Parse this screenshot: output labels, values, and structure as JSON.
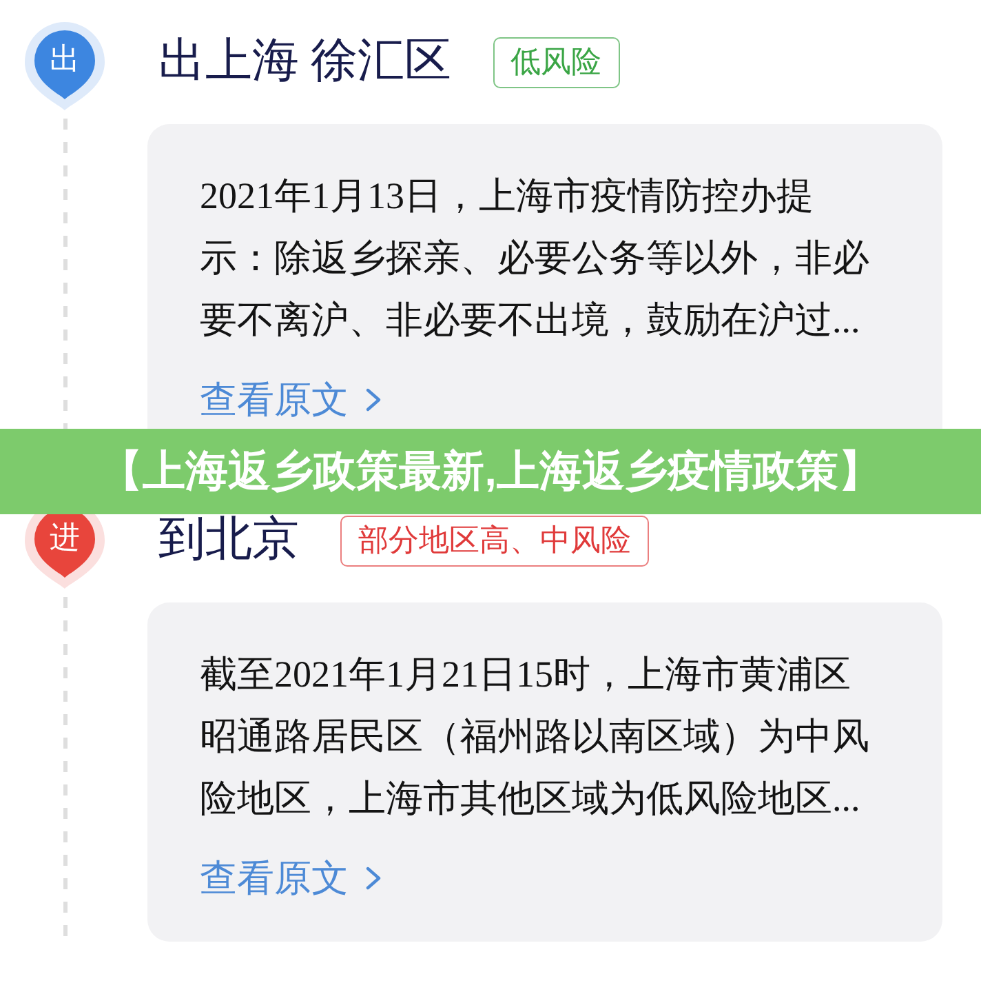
{
  "banner": {
    "title": "【上海返乡政策最新,上海返乡疫情政策】"
  },
  "entries": [
    {
      "marker": {
        "label": "出",
        "color": "#3d86e0"
      },
      "title": "出上海 徐汇区",
      "badge": {
        "text": "低风险",
        "color": "#3aa545"
      },
      "body_lines": [
        "2021年1月13日，上海市疫情防控办提",
        "示：除返乡探亲、必要公务等以外，非必",
        "要不离沪、非必要不出境，鼓励在沪过..."
      ],
      "link": "查看原文"
    },
    {
      "marker": {
        "label": "进",
        "color": "#e8453c"
      },
      "title": "到北京",
      "badge": {
        "text": "部分地区高、中风险",
        "color": "#e03a3a"
      },
      "body_lines": [
        "截至2021年1月21日15时，上海市黄浦区",
        "昭通路居民区（福州路以南区域）为中风",
        "险地区，上海市其他区域为低风险地区..."
      ],
      "link": "查看原文"
    }
  ]
}
